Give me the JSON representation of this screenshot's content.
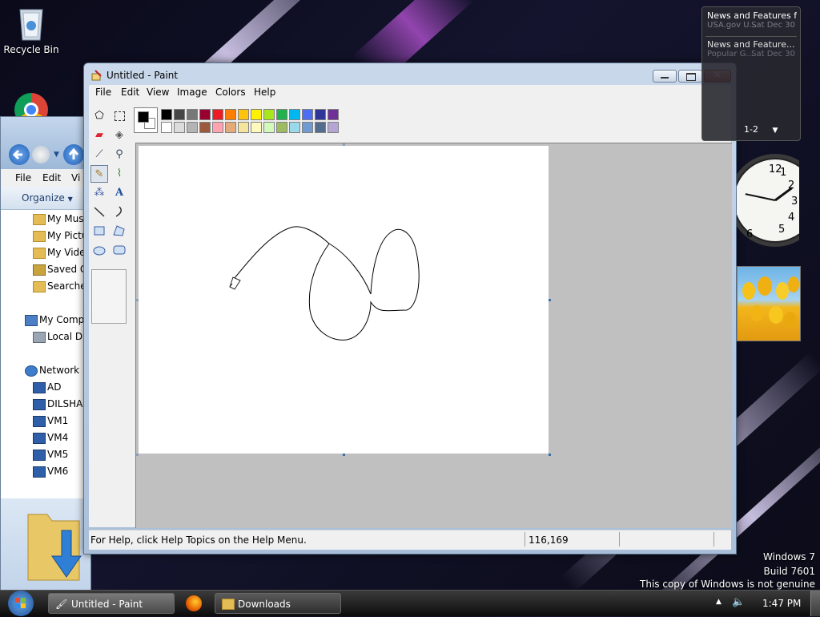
{
  "desktop": {
    "recycle_bin_label": "Recycle Bin",
    "genuine": {
      "line1": "Windows 7",
      "line2": "Build 7601",
      "line3": "This copy of Windows is not genuine"
    }
  },
  "explorer": {
    "menus": [
      "File",
      "Edit",
      "Vi"
    ],
    "organize_label": "Organize",
    "items": [
      {
        "label": "My Mus",
        "icon": "music-folder-icon"
      },
      {
        "label": "My Pictu",
        "icon": "pictures-folder-icon"
      },
      {
        "label": "My Vide",
        "icon": "videos-folder-icon"
      },
      {
        "label": "Saved G",
        "icon": "saved-games-folder-icon"
      },
      {
        "label": "Searches",
        "icon": "searches-folder-icon"
      },
      {
        "label": "My Comp",
        "icon": "computer-icon"
      },
      {
        "label": "Local Di",
        "icon": "local-disk-icon"
      },
      {
        "label": "Network",
        "icon": "network-icon"
      },
      {
        "label": "AD",
        "icon": "network-computer-icon"
      },
      {
        "label": "DILSHAD",
        "icon": "network-computer-icon"
      },
      {
        "label": "VM1",
        "icon": "network-computer-icon"
      },
      {
        "label": "VM4",
        "icon": "network-computer-icon"
      },
      {
        "label": "VM5",
        "icon": "network-computer-icon"
      },
      {
        "label": "VM6",
        "icon": "network-computer-icon"
      }
    ]
  },
  "paint": {
    "title": "Untitled - Paint",
    "menus": {
      "file": "File",
      "edit": "Edit",
      "view": "View",
      "image": "Image",
      "colors": "Colors",
      "help": "Help"
    },
    "status_help": "For Help, click Help Topics on the Help Menu.",
    "status_coords": "116,169",
    "foreground_color": "#000000",
    "background_color": "#ffffff",
    "palette_top": [
      "#000000",
      "#464646",
      "#787878",
      "#990030",
      "#ed1c24",
      "#ff7e00",
      "#ffc20e",
      "#fff200",
      "#a8e61d",
      "#22b14c",
      "#00b7ef",
      "#4d6df3",
      "#2f3699",
      "#6f3198"
    ],
    "palette_bottom": [
      "#ffffff",
      "#dcdcdc",
      "#b4b4b4",
      "#9c5a3c",
      "#ffa3b1",
      "#e5aa7a",
      "#f5e49c",
      "#fff9bd",
      "#d3f9bc",
      "#9dbb61",
      "#99d9ea",
      "#709ad1",
      "#546d8e",
      "#b5a5d5"
    ],
    "selected_tool": "pencil"
  },
  "gadgets": {
    "news": [
      {
        "title": "News and Features f...",
        "source": "USA.gov U...",
        "date": "Sat Dec 30"
      },
      {
        "title": "News and Feature...",
        "source": "Popular G...",
        "date": "Sat Dec 30"
      }
    ],
    "pager": "1-2",
    "clock": {
      "hour": 1,
      "minute": 47
    }
  },
  "taskbar": {
    "paint_label": "Untitled - Paint",
    "downloads_label": "Downloads",
    "time": "1:47 PM"
  }
}
